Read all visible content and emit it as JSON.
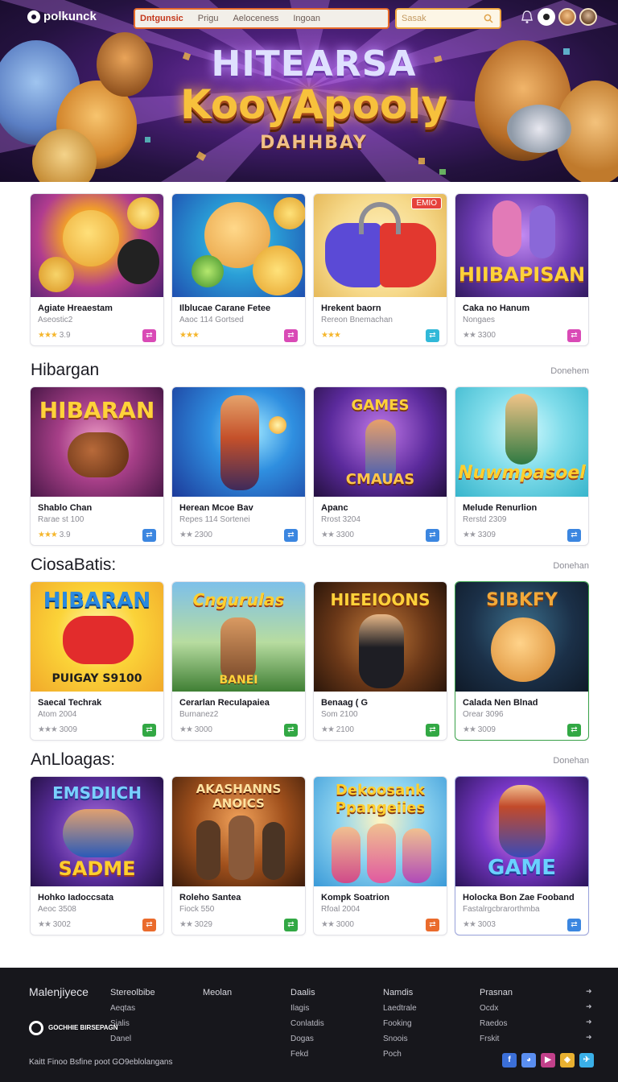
{
  "header": {
    "logo_text": "polkunck",
    "nav": [
      "Dntgunsic",
      "Prigu",
      "Aeloceness",
      "Ingoan"
    ],
    "search_placeholder": "Sasak"
  },
  "hero": {
    "line1": "HITEARSA",
    "line2": "KooyApooly",
    "line3": "DAHHBAY"
  },
  "sections": [
    {
      "title": "",
      "more": "",
      "cards": [
        {
          "title": "Agiate Hreaestam",
          "sub": "Aseostic2",
          "rating": "3.9",
          "stars": "★★★",
          "art_text": "",
          "badge": ""
        },
        {
          "title": "Ilblucae Carane Fetee",
          "sub": "Aaoc 114 Gortsed",
          "rating": "",
          "stars": "★★★",
          "art_text": "",
          "badge": ""
        },
        {
          "title": "Hrekent baorn",
          "sub": "Rereon Bnemachan",
          "rating": "",
          "stars": "★★★",
          "art_text": "",
          "badge": "EMIO"
        },
        {
          "title": "Caka no Hanum",
          "sub": "Nongaes",
          "rating": "3300",
          "stars": "★★",
          "art_text": "HIIBAPISAN",
          "badge": ""
        }
      ]
    },
    {
      "title": "Hibargan",
      "more": "Donehem",
      "cards": [
        {
          "title": "Shablo Chan",
          "sub": "Rarae st 100",
          "rating": "3.9",
          "stars": "★★★",
          "art_text": "HIBARAN",
          "badge": ""
        },
        {
          "title": "Herean Mcoe Bav",
          "sub": "Repes 114 Sortenei",
          "rating": "2300",
          "stars": "★★",
          "art_text": "",
          "badge": ""
        },
        {
          "title": "Apanc",
          "sub": "Rrost 3204",
          "rating": "3300",
          "stars": "★★",
          "art_text": "GAMES",
          "art_text2": "CMAUAS",
          "badge": ""
        },
        {
          "title": "Melude Renurlion",
          "sub": "Rerstd 2309",
          "rating": "3309",
          "stars": "★★",
          "art_text": "Nuwmpasoel",
          "badge": ""
        }
      ]
    },
    {
      "title": "CiosaBatis:",
      "more": "Donehan",
      "cards": [
        {
          "title": "Saecal Techrak",
          "sub": "Atom 2004",
          "rating": "3009",
          "stars": "★★★",
          "art_text": "HIBARAN",
          "art_text2": "PUIGAY S9100",
          "badge": ""
        },
        {
          "title": "Cerarlan Reculapaiea",
          "sub": "Burnanez2",
          "rating": "3000",
          "stars": "★★",
          "art_text": "Cngurulas",
          "art_text2": "BANEI",
          "badge": ""
        },
        {
          "title": "Benaag ( G",
          "sub": "Som 2100",
          "rating": "2100",
          "stars": "★★",
          "art_text": "HIEEIOONS",
          "badge": ""
        },
        {
          "title": "Calada Nen Blnad",
          "sub": "Orear 3096",
          "rating": "3009",
          "stars": "★★",
          "art_text": "SIBKFY",
          "badge": ""
        }
      ]
    },
    {
      "title": "AnLloagas:",
      "more": "Donehan",
      "cards": [
        {
          "title": "Hohko Iadoccsata",
          "sub": "Aeoc 3508",
          "rating": "3002",
          "stars": "★★",
          "art_text": "EMSDIICH",
          "art_text2": "SADME",
          "badge": ""
        },
        {
          "title": "Roleho Santea",
          "sub": "Fiock 550",
          "rating": "3029",
          "stars": "★★",
          "art_text": "AKASHANNS",
          "art_text2": "ANOICS",
          "badge": ""
        },
        {
          "title": "Kompk Soatrion",
          "sub": "Rfoal 2004",
          "rating": "3000",
          "stars": "★★",
          "art_text": "Dekoosank",
          "art_text2": "Ppangeiies",
          "badge": ""
        },
        {
          "title": "Holocka Bon Zae Fooband",
          "sub": "Fastalrgcbrarorthmba",
          "rating": "3003",
          "stars": "★★",
          "art_text": "GAME",
          "badge": ""
        }
      ]
    }
  ],
  "footer": {
    "brand": "Malenjiyece",
    "col1": [
      "Stereolbibe",
      "Aeqtas",
      "Sialis",
      "Danel"
    ],
    "col2_head": "Meolan",
    "col3": [
      "Daalis",
      "Ilagis",
      "Conlatdis",
      "Dogas",
      "Fekd"
    ],
    "col4": [
      "Namdis",
      "Laedtrale",
      "Fooking",
      "Snoois",
      "Poch"
    ],
    "col5": [
      "Prasnan",
      "Ocdx",
      "Raedos",
      "Frskit"
    ],
    "logo_text": "GOCHHIE BIRSEPAGN",
    "copyright": "Kaitt Finoo Bsfine poot GO9eblolangans"
  },
  "colors": {
    "pink": "#d94ab6",
    "cyan": "#31b8d8",
    "blue": "#3b86e0",
    "green": "#32a844",
    "orange": "#ea6b2c"
  }
}
